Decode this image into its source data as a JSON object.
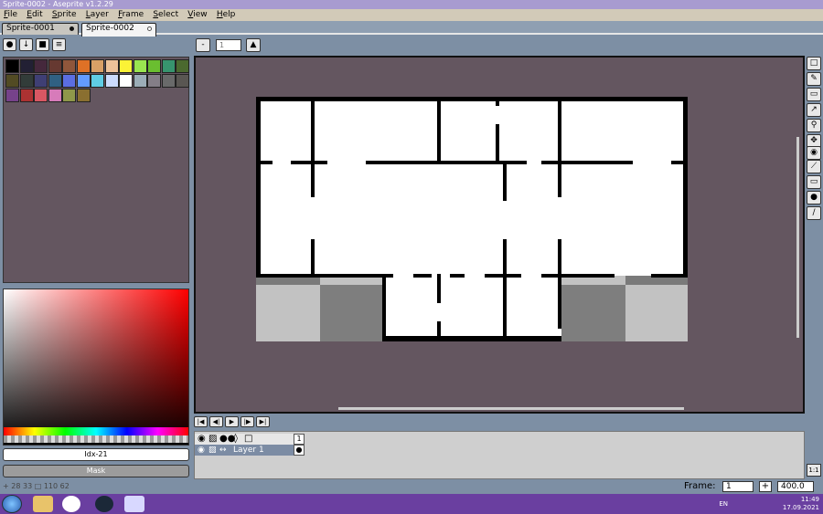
{
  "window": {
    "title": "Sprite-0002 - Aseprite v1.2.29"
  },
  "menu": [
    "File",
    "Edit",
    "Sprite",
    "Layer",
    "Frame",
    "Select",
    "View",
    "Help"
  ],
  "tabs": [
    {
      "label": "Sprite-0001"
    },
    {
      "label": "Sprite-0002",
      "active": true
    }
  ],
  "toolbar": {
    "minus_label": "-",
    "zoom_value": "1",
    "zoom_placeholder": "1"
  },
  "palette": {
    "colors": [
      "#000000",
      "#222034",
      "#45283c",
      "#663931",
      "#8f563b",
      "#df7126",
      "#d9a066",
      "#eec39a",
      "#fbf236",
      "#99e550",
      "#6abe30",
      "#37946e",
      "#4b692f",
      "#524b24",
      "#323c39",
      "#3f3f74",
      "#306082",
      "#5b6ee1",
      "#639bff",
      "#5fcde4",
      "#cbdbfc",
      "#ffffff",
      "#9badb7",
      "#847e87",
      "#696a6a",
      "#595652",
      "#76428a",
      "#ac3232",
      "#d95763",
      "#d77bba",
      "#8f974a",
      "#8a6f30"
    ]
  },
  "color_bar": {
    "index_label": "Idx-21",
    "mask_label": "Mask"
  },
  "status": {
    "cursor": "28 33",
    "selection_icon": "rect",
    "size": "110 62"
  },
  "timeline": {
    "layer_name": "Layer 1",
    "frame_number": "1"
  },
  "frame_bar": {
    "frame_label": "Frame:",
    "frame_value": "1",
    "plus_label": "+",
    "zoom_value": "400.0",
    "fit_label": "1:1"
  },
  "taskbar": {
    "lang": "EN",
    "time": "11:49",
    "date": "17.09.2021"
  },
  "colors": {
    "canvas_bg": "#645660",
    "accent": "#7c8ca4",
    "taskbar": "#6a3fa0"
  }
}
